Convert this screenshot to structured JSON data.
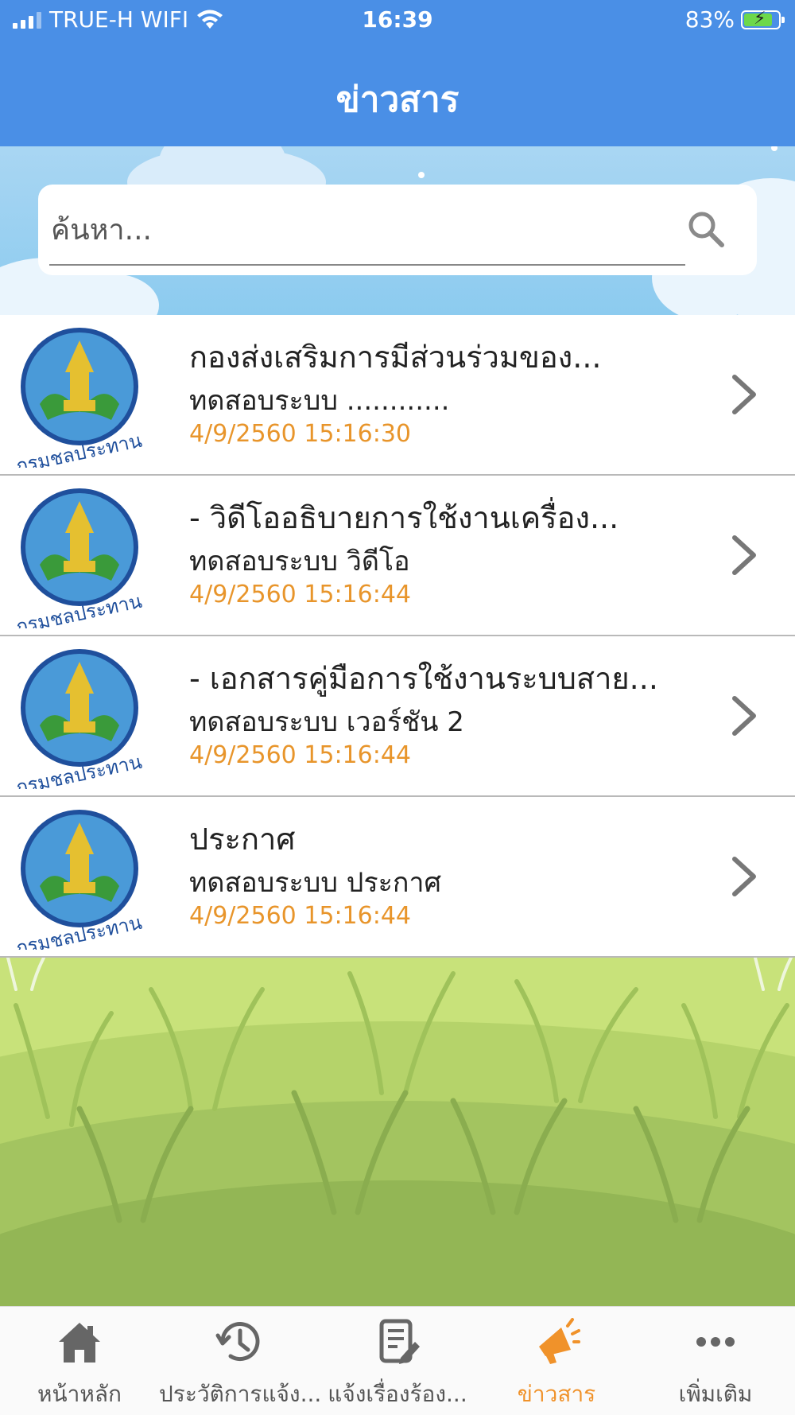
{
  "status_bar": {
    "carrier": "TRUE-H WIFI",
    "time": "16:39",
    "battery": "83%",
    "battery_level": 0.83
  },
  "header": {
    "title": "ข่าวสาร"
  },
  "search": {
    "placeholder": "ค้นหา..."
  },
  "news": [
    {
      "title": "กองส่งเสริมการมีส่วนร่วมของ...",
      "subtitle": "ทดสอบระบบ ............",
      "date": "4/9/2560  15:16:30"
    },
    {
      "title": "- วิดีโออธิบายการใช้งานเครื่อง...",
      "subtitle": "ทดสอบระบบ วิดีโอ",
      "date": "4/9/2560  15:16:44"
    },
    {
      "title": "- เอกสารคู่มือการใช้งานระบบสาย...",
      "subtitle": "ทดสอบระบบ เวอร์ชัน 2",
      "date": "4/9/2560  15:16:44"
    },
    {
      "title": "ประกาศ",
      "subtitle": "ทดสอบระบบ ประกาศ",
      "date": "4/9/2560  15:16:44"
    }
  ],
  "logo_text": "กรมชลประทาน",
  "tabs": [
    {
      "label": "หน้าหลัก",
      "icon": "home-icon"
    },
    {
      "label": "ประวัติการแจ้ง...",
      "icon": "history-icon"
    },
    {
      "label": "แจ้งเรื่องร้อง...",
      "icon": "report-icon"
    },
    {
      "label": "ข่าวสาร",
      "icon": "megaphone-icon",
      "active": true
    },
    {
      "label": "เพิ่มเติม",
      "icon": "more-icon"
    }
  ],
  "colors": {
    "header": "#4a8fe6",
    "active_tab": "#f0922a",
    "date": "#e8952b"
  }
}
